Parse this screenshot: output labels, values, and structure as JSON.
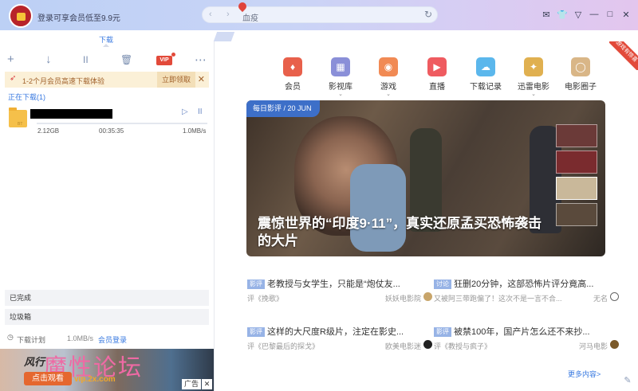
{
  "titlebar": {
    "vip_promo": "登录可享会员低至9.9元",
    "search_text": "血疫",
    "back": "‹",
    "forward": "›",
    "refresh": "↻",
    "window_buttons": [
      "✉",
      "👕",
      "▽",
      "—",
      "□",
      "✕"
    ]
  },
  "left": {
    "tab_label": "下载",
    "toolbar": [
      "+",
      "↓",
      "II",
      "🗑",
      "⋯"
    ],
    "vip_badge": "VIP",
    "promo": {
      "text": "1-2个月会员高速下载体验",
      "button": "立即领取",
      "close": "✕"
    },
    "downloading_title": "正在下载(1)",
    "task": {
      "folder_badge": "BT",
      "size": "2.12GB",
      "time": "00:35:35",
      "speed": "1.0MB/s",
      "progress": 0.0,
      "play": "▷",
      "pause": "II"
    },
    "completed": "已完成",
    "trash": "垃圾箱",
    "plan": {
      "label": "下载计划",
      "speed": "1.0MB/s",
      "member_login": "会员登录"
    },
    "ad": {
      "title": "风行",
      "watermark": "魔性论坛",
      "cta": "点击观看",
      "brand": "vip.2x.com",
      "tag": "广告",
      "close": "✕"
    }
  },
  "right": {
    "corner_badge": "游戏有惊喜",
    "nav": [
      {
        "label": "会员",
        "color": "#e8604b",
        "glyph": "♦",
        "arrow": false
      },
      {
        "label": "影视库",
        "color": "#8a8fd8",
        "glyph": "▦",
        "arrow": true
      },
      {
        "label": "游戏",
        "color": "#f18a54",
        "glyph": "◉",
        "arrow": true
      },
      {
        "label": "直播",
        "color": "#ef5b60",
        "glyph": "▶",
        "arrow": false
      },
      {
        "label": "下载记录",
        "color": "#5bb7ec",
        "glyph": "☁",
        "arrow": false
      },
      {
        "label": "迅雷电影",
        "color": "#e0b050",
        "glyph": "✦",
        "arrow": true
      },
      {
        "label": "电影圈子",
        "color": "#d9b687",
        "glyph": "◯",
        "arrow": false
      }
    ],
    "hero": {
      "tag": "每日影评 / 20 JUN",
      "caption": "震惊世界的“印度9·11”，真实还原孟买恐怖袭击的大片"
    },
    "news": [
      {
        "badge": "影评",
        "title": "老教授与女学生，只能是“炮仗友...",
        "sub": "评《挽歌》",
        "source": "妖妖电影院"
      },
      {
        "badge": "讨论",
        "title": "狂删20分钟，这部恐怖片评分竟高...",
        "sub": "又被阿三带跑偏了！这次不是一言不合...",
        "source": "无名"
      },
      {
        "badge": "影评",
        "title": "这样的大尺度R级片，注定在影史...",
        "sub": "评《巴黎最后的探戈》",
        "source": "欧美电影迷"
      },
      {
        "badge": "影评",
        "title": "被禁100年，国产片怎么还不来抄...",
        "sub": "评《教授与疯子》",
        "source": "河马电影"
      }
    ],
    "more": "更多内容>"
  }
}
